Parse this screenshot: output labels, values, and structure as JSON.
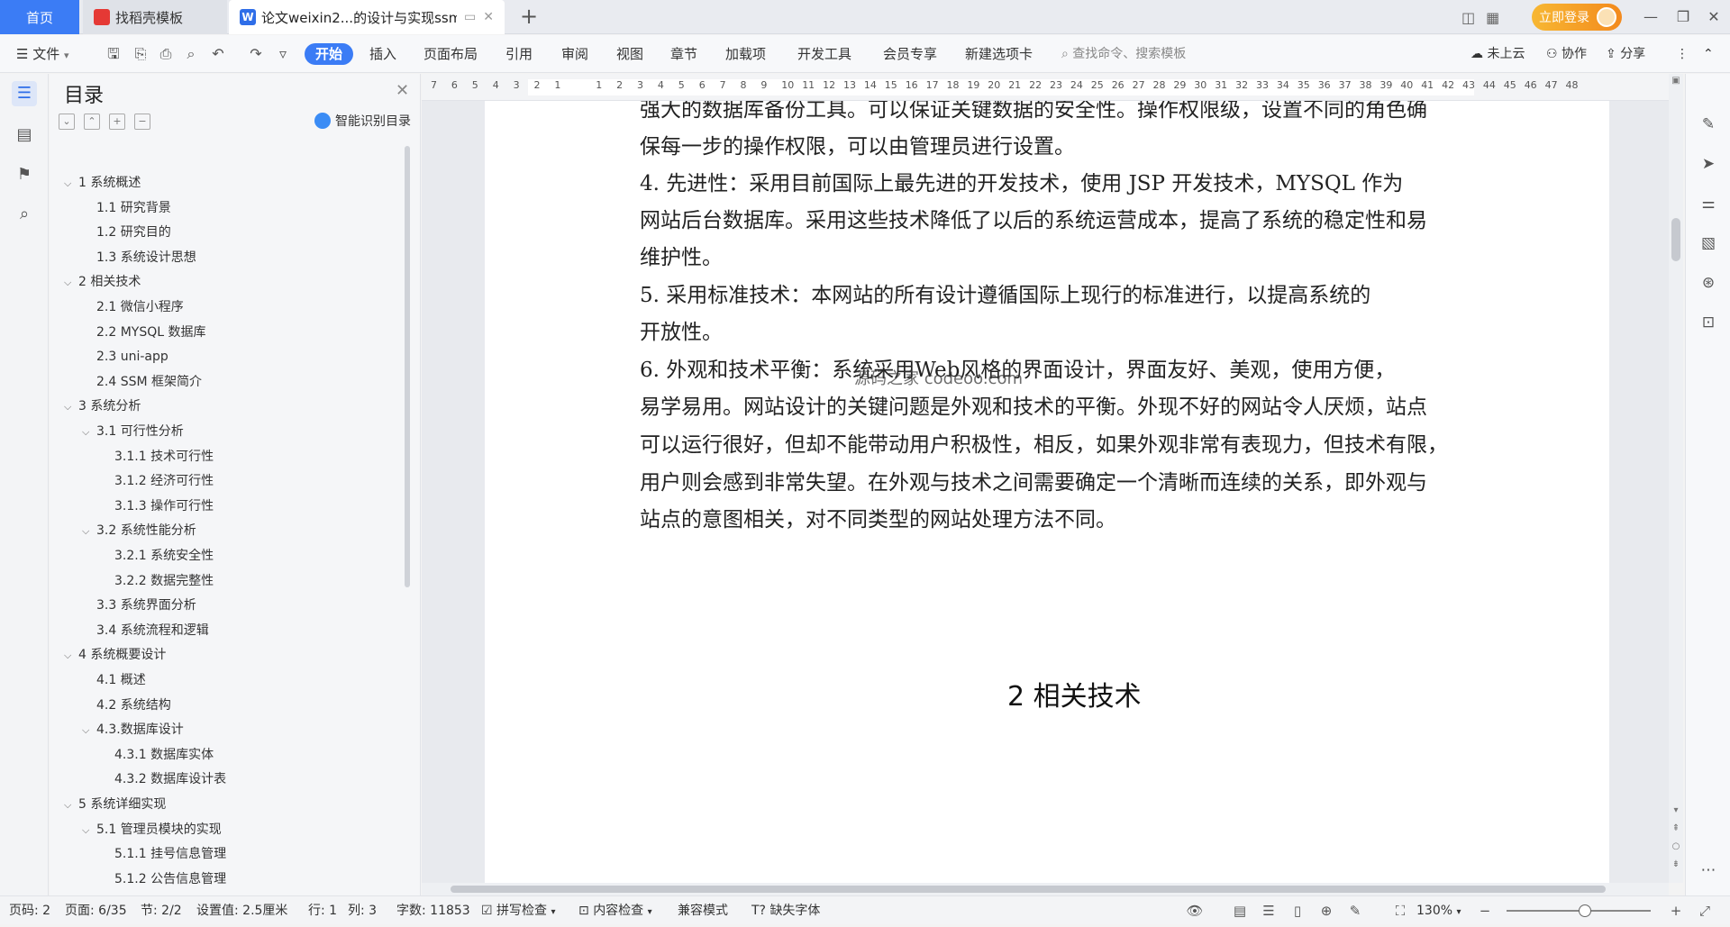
{
  "titlebar": {
    "tabs": [
      {
        "label": "首页"
      },
      {
        "label": "找稻壳模板"
      },
      {
        "label": "论文weixin2...的设计与实现ssm"
      }
    ],
    "login_label": "立即登录"
  },
  "menubar": {
    "file_label": "文件",
    "tabs": [
      "开始",
      "插入",
      "页面布局",
      "引用",
      "审阅",
      "视图",
      "章节",
      "加载项",
      "开发工具",
      "会员专享",
      "新建选项卡"
    ],
    "search_placeholder": "查找命令、搜索模板",
    "cloud_label": "未上云",
    "collab_label": "协作",
    "share_label": "分享"
  },
  "toc": {
    "title": "目录",
    "smart_label": "智能识别目录",
    "items": [
      {
        "label": "1 系统概述",
        "level": 1,
        "expandable": true
      },
      {
        "label": "1.1  研究背景",
        "level": 2,
        "expandable": false
      },
      {
        "label": "1.2 研究目的",
        "level": 2,
        "expandable": false
      },
      {
        "label": "1.3 系统设计思想",
        "level": 2,
        "expandable": false
      },
      {
        "label": "2 相关技术",
        "level": 1,
        "expandable": true
      },
      {
        "label": "2.1 微信小程序",
        "level": 2,
        "expandable": false
      },
      {
        "label": "2.2 MYSQL 数据库",
        "level": 2,
        "expandable": false
      },
      {
        "label": "2.3 uni-app",
        "level": 2,
        "expandable": false
      },
      {
        "label": "2.4 SSM 框架简介",
        "level": 2,
        "expandable": false
      },
      {
        "label": "3 系统分析",
        "level": 1,
        "expandable": true
      },
      {
        "label": "3.1 可行性分析",
        "level": 2,
        "expandable": true
      },
      {
        "label": "3.1.1 技术可行性",
        "level": 3,
        "expandable": false
      },
      {
        "label": "3.1.2 经济可行性",
        "level": 3,
        "expandable": false
      },
      {
        "label": "3.1.3 操作可行性",
        "level": 3,
        "expandable": false
      },
      {
        "label": "3.2 系统性能分析",
        "level": 2,
        "expandable": true
      },
      {
        "label": "3.2.1  系统安全性",
        "level": 3,
        "expandable": false
      },
      {
        "label": "3.2.2  数据完整性",
        "level": 3,
        "expandable": false
      },
      {
        "label": "3.3 系统界面分析",
        "level": 2,
        "expandable": false
      },
      {
        "label": "3.4 系统流程和逻辑",
        "level": 2,
        "expandable": false
      },
      {
        "label": "4 系统概要设计",
        "level": 1,
        "expandable": true
      },
      {
        "label": "4.1 概述",
        "level": 2,
        "expandable": false
      },
      {
        "label": "4.2 系统结构",
        "level": 2,
        "expandable": false
      },
      {
        "label": "4.3.数据库设计",
        "level": 2,
        "expandable": true
      },
      {
        "label": "4.3.1 数据库实体",
        "level": 3,
        "expandable": false
      },
      {
        "label": "4.3.2 数据库设计表",
        "level": 3,
        "expandable": false
      },
      {
        "label": "5 系统详细实现",
        "level": 1,
        "expandable": true
      },
      {
        "label": "5.1  管理员模块的实现",
        "level": 2,
        "expandable": true
      },
      {
        "label": "5.1.1  挂号信息管理",
        "level": 3,
        "expandable": false
      },
      {
        "label": "5.1.2  公告信息管理",
        "level": 3,
        "expandable": false
      }
    ]
  },
  "ruler": {
    "numbers": [
      "7",
      "6",
      "5",
      "4",
      "3",
      "2",
      "1",
      "",
      "1",
      "2",
      "3",
      "4",
      "5",
      "6",
      "7",
      "8",
      "9",
      "10",
      "11",
      "12",
      "13",
      "14",
      "15",
      "16",
      "17",
      "18",
      "19",
      "20",
      "21",
      "22",
      "23",
      "24",
      "25",
      "26",
      "27",
      "28",
      "29",
      "30",
      "31",
      "32",
      "33",
      "34",
      "35",
      "36",
      "37",
      "38",
      "39",
      "40",
      "41",
      "42",
      "43",
      "44",
      "45",
      "46",
      "47",
      "48"
    ]
  },
  "document": {
    "lines": [
      "强大的数据库备份工具。可以保证关键数据的安全性。操作权限级，设置不同的角色确",
      "保每一步的操作权限，可以由管理员进行设置。",
      "  4.      先进性：采用目前国际上最先进的开发技术，使用 JSP 开发技术，MYSQL 作为",
      "网站后台数据库。采用这些技术降低了以后的系统运营成本，提高了系统的稳定性和易",
      "维护性。",
      "  5.      采用标准技术：本网站的所有设计遵循国际上现行的标准进行，以提高系统的",
      "开放性。",
      "  6.      外观和技术平衡：系统采用Web风格的界面设计，界面友好、美观，使用方便，",
      "易学易用。网站设计的关键问题是外观和技术的平衡。外现不好的网站令人厌烦，站点",
      "可以运行很好，但却不能带动用户积极性，相反，如果外观非常有表现力，但技术有限，",
      "用户则会感到非常失望。在外观与技术之间需要确定一个清晰而连续的关系，即外观与",
      "站点的意图相关，对不同类型的网站处理方法不同。"
    ],
    "watermark": "源码之家 codeoo.com",
    "heading": "2 相关技术"
  },
  "statusbar": {
    "page_code": "页码: 2",
    "page": "页面: 6/35",
    "section": "节: 2/2",
    "setting": "设置值: 2.5厘米",
    "row": "行: 1",
    "col": "列: 3",
    "word_count": "字数: 11853",
    "spell_check": "拼写检查",
    "content_check": "内容检查",
    "compat_mode": "兼容模式",
    "missing_font": "缺失字体",
    "zoom": "130%"
  },
  "colors": {
    "accent": "#3b7cf5",
    "login_gradient_start": "#f7b733",
    "login_gradient_end": "#f38a1d"
  }
}
